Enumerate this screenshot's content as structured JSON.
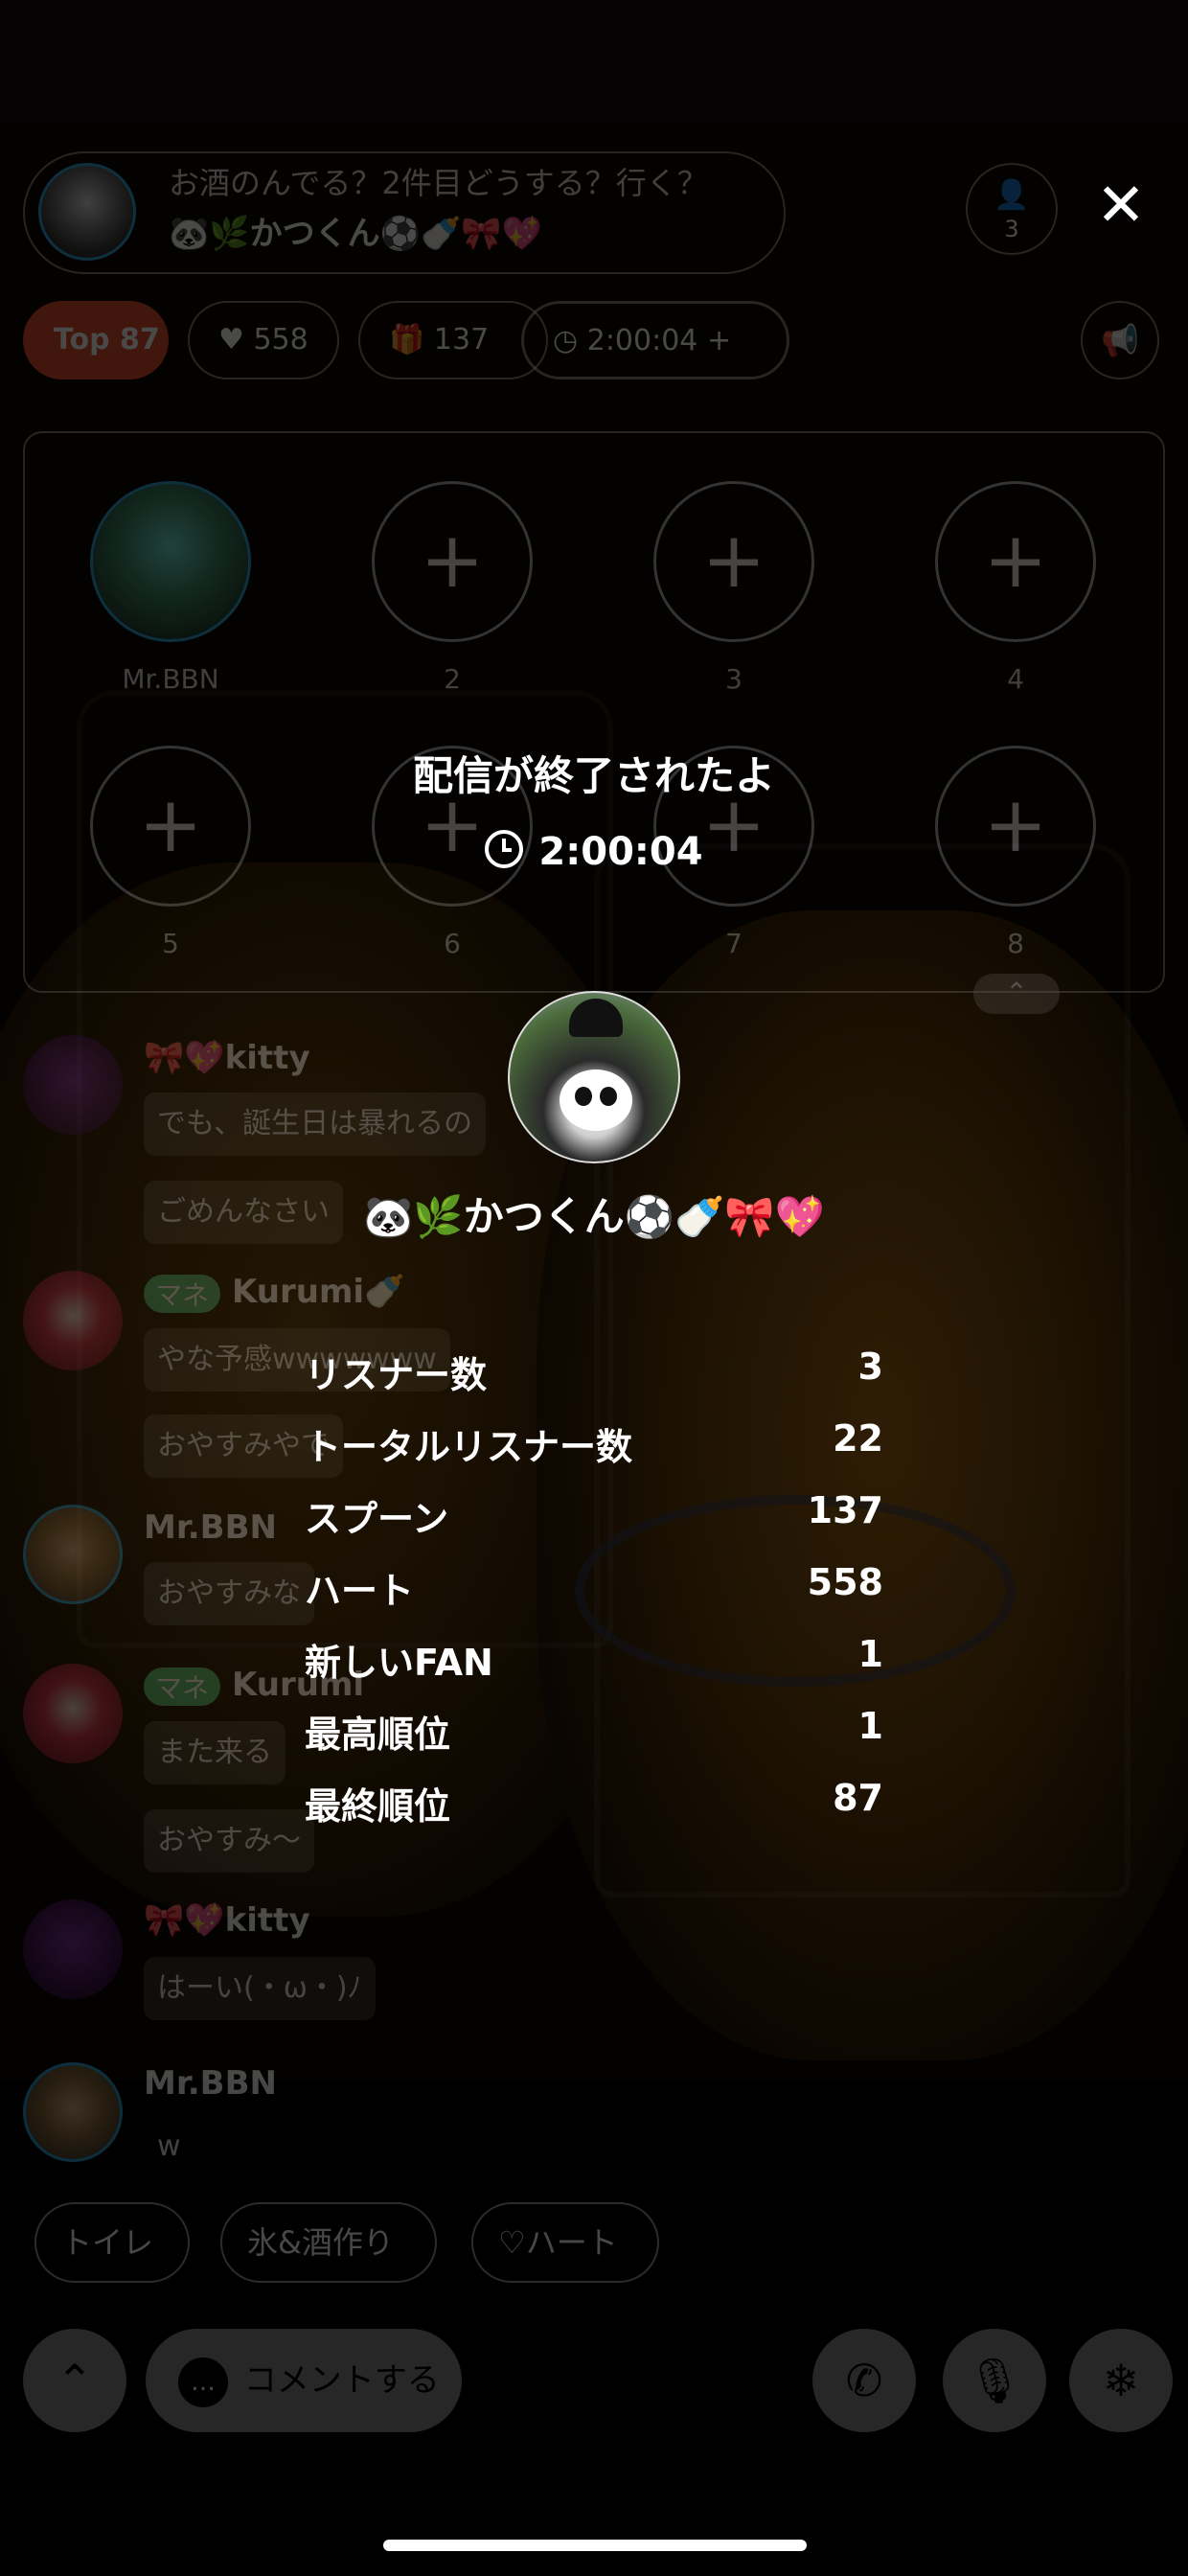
{
  "header": {
    "title": "お酒のんでる？2件目どうする？行く？",
    "host": "🐼🌿かつくん⚽️🍼🎀💖",
    "listener_icon": "person-icon",
    "listener_count": "3",
    "close": "✕"
  },
  "stats_bar": {
    "top_label": "Top",
    "top_rank": "87",
    "hearts": "558",
    "spoons": "137",
    "time": "2:00:04",
    "add": "+"
  },
  "seats": [
    {
      "label": "Mr.BBN",
      "filled": true
    },
    {
      "label": "2",
      "filled": false
    },
    {
      "label": "3",
      "filled": false
    },
    {
      "label": "4",
      "filled": false
    },
    {
      "label": "5",
      "filled": false
    },
    {
      "label": "6",
      "filled": false
    },
    {
      "label": "7",
      "filled": false
    },
    {
      "label": "8",
      "filled": false
    }
  ],
  "chat": {
    "badge": "マネ",
    "messages": [
      {
        "name": "🎀💖kitty",
        "lines": [
          "でも、誕生日は暴れるの",
          "ごめんなさい"
        ]
      },
      {
        "name": "Kurumi🍼",
        "lines": [
          "やな予感wwwwwww",
          "おやすみやで"
        ]
      },
      {
        "name": "Mr.BBN",
        "lines": [
          "おやすみな"
        ]
      },
      {
        "name": "Kurumi",
        "lines": [
          "また来る",
          "おやすみ〜"
        ]
      },
      {
        "name": "🎀💖kitty",
        "lines": [
          "はーい(・ω・)ﾉ"
        ]
      },
      {
        "name": "Mr.BBN",
        "lines": [
          "w"
        ]
      }
    ]
  },
  "quick_replies": [
    "トイレ",
    "氷&酒作り",
    "♡ハート"
  ],
  "bottom_bar": {
    "comment": "コメントする"
  },
  "end_overlay": {
    "title": "配信が終了されたよ",
    "duration": "2:00:04",
    "host_name": "🐼🌿かつくん⚽️🍼🎀💖",
    "stats": [
      {
        "label": "リスナー数",
        "value": "3"
      },
      {
        "label": "トータルリスナー数",
        "value": "22"
      },
      {
        "label": "スプーン",
        "value": "137"
      },
      {
        "label": "ハート",
        "value": "558"
      },
      {
        "label": "新しいFAN",
        "value": "1"
      },
      {
        "label": "最高順位",
        "value": "1"
      },
      {
        "label": "最終順位",
        "value": "87"
      }
    ]
  },
  "colors": {
    "rank_badge": "#e24a2c",
    "manager_badge": "#4fbf7a",
    "avatar_ring": "#2ba3d8"
  }
}
